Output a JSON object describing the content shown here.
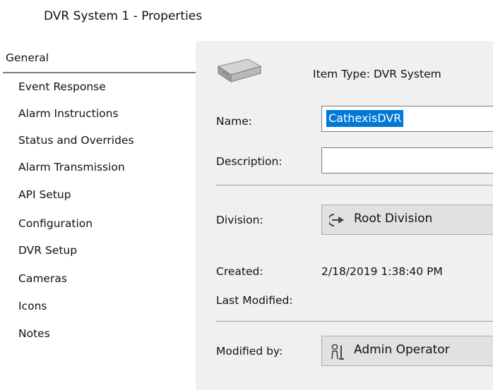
{
  "window": {
    "title": "DVR System 1 - Properties"
  },
  "sidebar": {
    "items": [
      {
        "label": "General",
        "selected": true
      },
      {
        "label": "Event Response"
      },
      {
        "label": "Alarm Instructions"
      },
      {
        "label": "Status and Overrides"
      },
      {
        "label": "Alarm Transmission"
      },
      {
        "label": "API Setup"
      },
      {
        "label": "Configuration"
      },
      {
        "label": "DVR Setup"
      },
      {
        "label": "Cameras"
      },
      {
        "label": "Icons"
      },
      {
        "label": "Notes"
      }
    ]
  },
  "general": {
    "item_type": "Item Type:  DVR System",
    "name_label": "Name:",
    "name_value": "CathexisDVR",
    "description_label": "Description:",
    "description_value": "",
    "division_label": "Division:",
    "division_value": "Root Division",
    "created_label": "Created:",
    "created_value": "2/18/2019 1:38:40 PM",
    "last_modified_label": "Last Modified:",
    "modified_by_label": "Modified by:",
    "modified_by_value": "Admin Operator"
  },
  "icons": {
    "item_type": "dvr-device-icon",
    "division": "division-icon",
    "modified_by": "operator-icon"
  },
  "colors": {
    "selection": "#0078d7",
    "panel_bg": "#f0f0f0",
    "picker_bg": "#e1e1e1"
  }
}
